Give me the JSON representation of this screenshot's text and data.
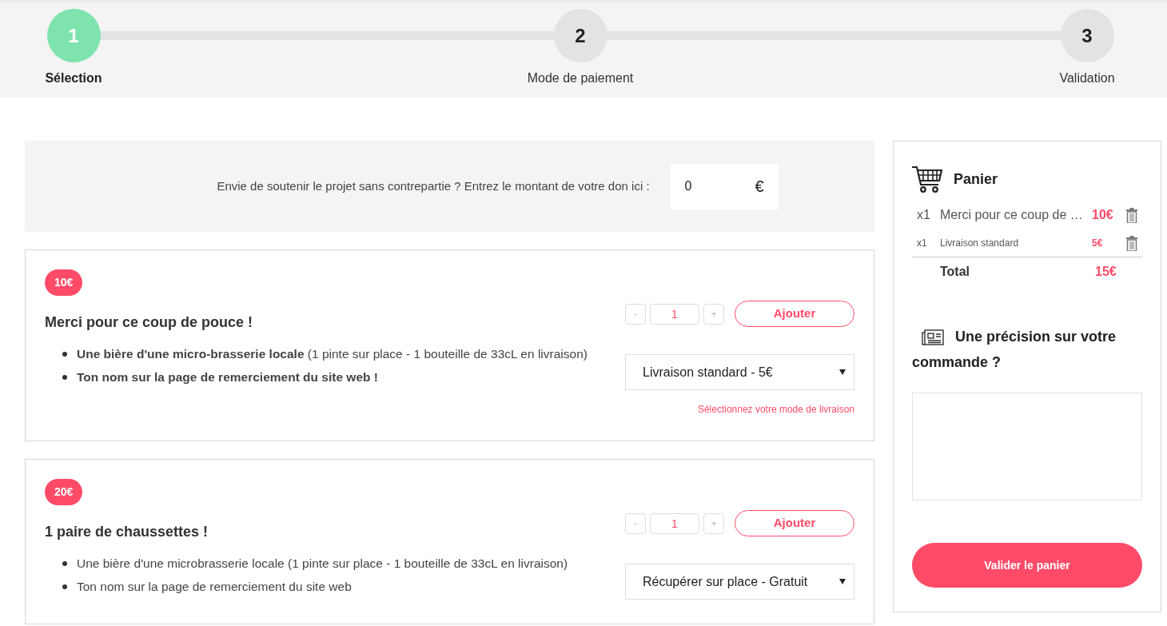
{
  "steps": [
    {
      "number": "1",
      "label": "Sélection",
      "selected": true
    },
    {
      "number": "2",
      "label": "Mode de paiement",
      "selected": false
    },
    {
      "number": "3",
      "label": "Validation",
      "selected": false
    }
  ],
  "donation": {
    "label": "Envie de soutenir le projet sans contrepartie ? Entrez le montant de votre don ici :",
    "value": "0",
    "currency": "€"
  },
  "rewards": [
    {
      "price": "10€",
      "title": "Merci pour ce coup de pouce !",
      "items": [
        "**Une bière d'une micro-brasserie locale** (1 pinte sur place - 1 bouteille de 33cL en livraison)",
        "**Ton nom sur la page de remerciement du site web !**"
      ],
      "minus": "-",
      "quantity": "1",
      "plus": "+",
      "add": "Ajouter",
      "delivery": "Livraison standard - 5€",
      "hint": "Sélectionnez votre mode de livraison"
    },
    {
      "price": "20€",
      "title": "1 paire de chaussettes !",
      "items": [
        "Une bière d'une microbrasserie locale (1 pinte sur place - 1 bouteille de 33cL en livraison)",
        "Ton nom sur la page de remerciement du site web"
      ],
      "minus": "-",
      "quantity": "1",
      "plus": "+",
      "add": "Ajouter",
      "delivery": "Récupérer sur place - Gratuit"
    }
  ],
  "cart": {
    "title": "Panier",
    "lines": [
      {
        "kind": "main",
        "qty": "x1",
        "name": "Merci pour ce coup de …",
        "price": "10€"
      },
      {
        "kind": "sub",
        "qty": "x1",
        "name": "Livraison standard",
        "price": "5€"
      }
    ],
    "total_label": "Total",
    "total": "15€",
    "note_title": [
      "Une précision sur votre",
      "commande ?"
    ],
    "submit": "Valider le panier"
  }
}
